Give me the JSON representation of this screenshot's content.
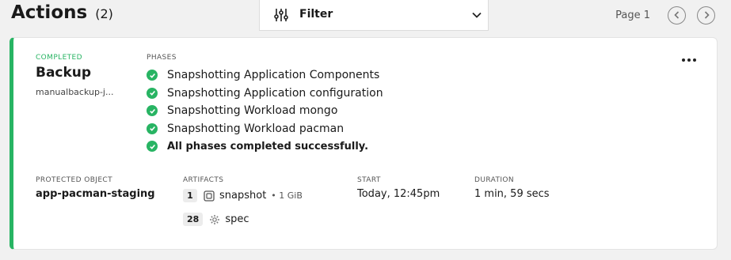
{
  "header": {
    "title": "Actions",
    "count": "(2)",
    "filter_label": "Filter",
    "page_label": "Page 1"
  },
  "action": {
    "status": "COMPLETED",
    "type": "Backup",
    "name": "manualbackup-j...",
    "phases_label": "PHASES",
    "phases": [
      "Snapshotting Application Components",
      "Snapshotting Application configuration",
      "Snapshotting Workload mongo",
      "Snapshotting Workload pacman",
      "All phases completed successfully."
    ],
    "protected_object_label": "PROTECTED OBJECT",
    "protected_object": "app-pacman-staging",
    "artifacts_label": "ARTIFACTS",
    "artifacts": [
      {
        "count": "1",
        "name": "snapshot",
        "size": "• 1 GiB",
        "icon": "snapshot-icon"
      },
      {
        "count": "28",
        "name": "spec",
        "size": "",
        "icon": "gear-icon"
      }
    ],
    "start_label": "START",
    "start": "Today, 12:45pm",
    "duration_label": "DURATION",
    "duration": "1 min, 59 secs"
  },
  "colors": {
    "success": "#28b463",
    "background": "#f1f1f1"
  }
}
